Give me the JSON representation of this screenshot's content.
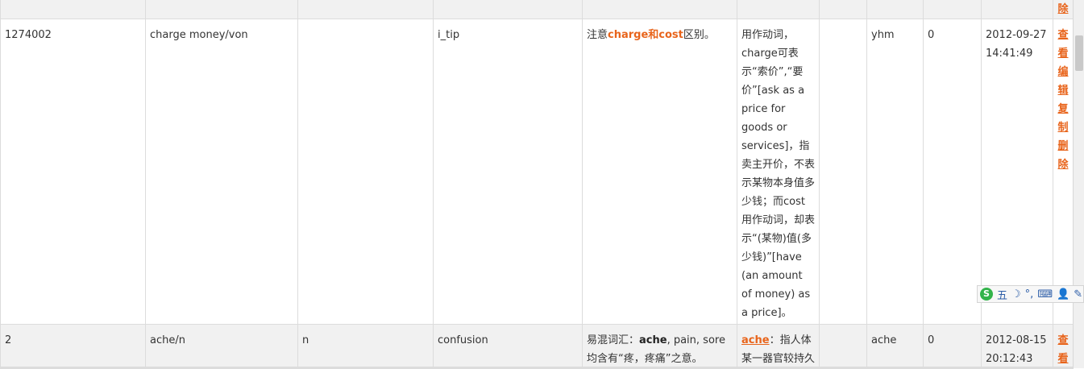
{
  "rows": [
    {
      "delete_partial": "除"
    },
    {
      "id": "1274002",
      "word": "charge money/von",
      "pos": "",
      "type": "i_tip",
      "note_prefix": "注意",
      "note_hl": "charge和cost",
      "note_suffix": "区别。",
      "explain": "用作动词，charge可表示“索价”,“要价”[ask as a price for goods or services]，指卖主开价，不表示某物本身值多少钱；而cost用作动词，却表示“(某物)值(多少钱)”[have (an amount of money) as a price]。",
      "extra": "",
      "user": "yhm",
      "count": "0",
      "date": "2012-09-27",
      "time": "14:41:49",
      "actions": [
        "查看",
        "编辑",
        "复制",
        "删除"
      ]
    },
    {
      "id": "2",
      "word": "ache/n",
      "pos": "n",
      "type": "confusion",
      "note_prefix": "易混词汇：",
      "note_b1": "ache",
      "note_rest": ", pain, sore",
      "note_line2": "均含有“疼，疼痛”之意。",
      "explain_hl": "ache",
      "explain_rest": "：指人体某一器官较持久",
      "extra": "",
      "user": "ache",
      "count": "0",
      "date": "2012-08-15",
      "time": "20:12:43",
      "actions": [
        "查看"
      ]
    }
  ],
  "ime_toolbar": {
    "logo": "S",
    "mode": "五",
    "moon": "☽",
    "punct": "°,",
    "keyboard": "⌨",
    "user": "👤",
    "tools": "✎"
  }
}
